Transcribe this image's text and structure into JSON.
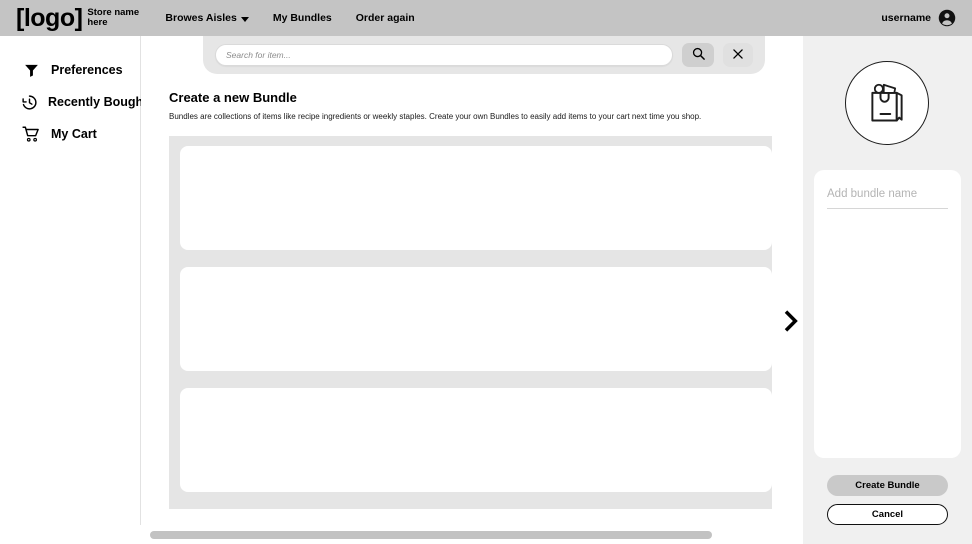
{
  "header": {
    "logo_text": "[logo]",
    "store_name": "Store name here",
    "nav": [
      {
        "label": "Browes Aisles",
        "icon": "chevron-down-icon",
        "has_caret": true
      },
      {
        "label": "My Bundles",
        "has_caret": false
      },
      {
        "label": "Order again",
        "has_caret": false
      }
    ],
    "user": {
      "name": "username",
      "icon": "account-circle-icon"
    },
    "background_color": "#c4c4c4"
  },
  "sidebar": {
    "items": [
      {
        "label": "Preferences",
        "icon": "filter-funnel-icon"
      },
      {
        "label": "Recently Bought",
        "icon": "clock-history-icon"
      },
      {
        "label": "My Cart",
        "icon": "shopping-cart-icon"
      }
    ]
  },
  "search": {
    "placeholder": "Search for item...",
    "value": "",
    "search_button_icon": "search-icon",
    "clear_button_icon": "close-x-icon"
  },
  "main": {
    "title": "Create a new Bundle",
    "description": "Bundles are collections of items like recipe ingredients or weekly staples. Create your own Bundles to easily add items to your cart next time you shop.",
    "next_button_icon": "chevron-right-icon",
    "skeleton_rows": 3,
    "skeleton_background": "#e5e5e5",
    "skeleton_card_color": "#ffffff"
  },
  "right_panel": {
    "bundle_avatar_icon": "grocery-bag-icon",
    "bundle_name": {
      "placeholder": "Add bundle name",
      "value": ""
    },
    "create_button_label": "Create Bundle",
    "cancel_button_label": "Cancel",
    "background_color": "#f0f0f0",
    "primary_button_color": "#c9c9c9"
  },
  "scrollbar": {
    "orientation": "horizontal",
    "thumb_color": "#c2c2c2"
  }
}
